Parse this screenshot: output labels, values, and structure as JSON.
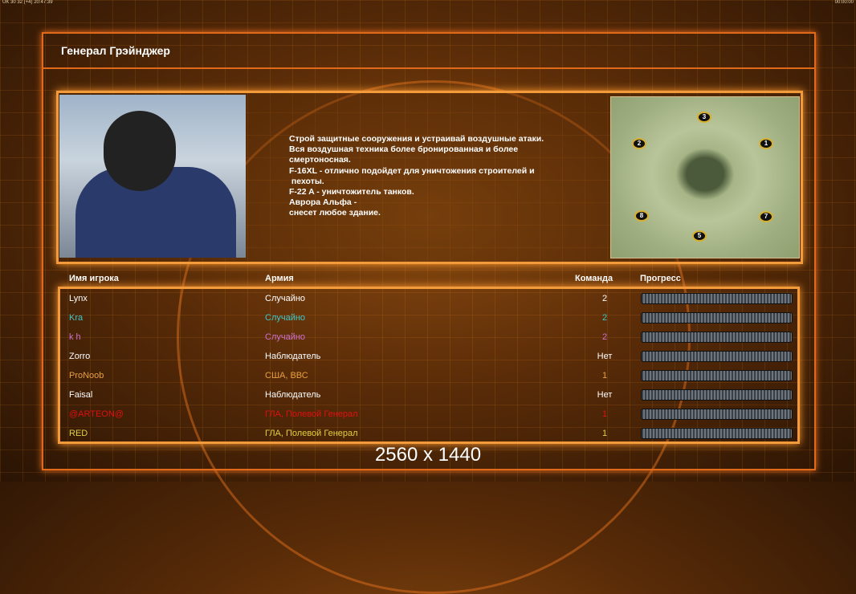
{
  "status_bar": {
    "left": "UK 30 32 (+4) 20:47:39",
    "right": "00:00:00"
  },
  "general": {
    "title": "Генерал Грэйнджер",
    "description": "Строй защитные сооружения и устраивай воздушные атаки.\nВся воздушная техника более бронированная и более\nсмертоносная.\nF-16XL - отлично подойдет для уничтожения строителей и\n пехоты.\nF-22 A - уничтожитель танков.\nАврора Альфа -\nснесет любое здание."
  },
  "map": {
    "start_positions": [
      "3",
      "2",
      "1",
      "8",
      "7",
      "5"
    ]
  },
  "table": {
    "headers": {
      "name": "Имя игрока",
      "army": "Армия",
      "team": "Команда",
      "progress": "Прогресс"
    },
    "rows": [
      {
        "name": "Lynx",
        "army": "Случайно",
        "team": "2",
        "color": "#ffffff",
        "progress": 0
      },
      {
        "name": "Kra",
        "army": "Случайно",
        "team": "2",
        "color": "#3fc8c8",
        "progress": 0
      },
      {
        "name": "k h",
        "army": "Случайно",
        "team": "2",
        "color": "#d070d0",
        "progress": 0
      },
      {
        "name": "Zorro",
        "army": "Наблюдатель",
        "team": "Нет",
        "color": "#ffffff",
        "progress": 0
      },
      {
        "name": "ProNoob",
        "army": "США, ВВС",
        "team": "1",
        "color": "#e8a040",
        "progress": 0
      },
      {
        "name": "Faisal",
        "army": "Наблюдатель",
        "team": "Нет",
        "color": "#ffffff",
        "progress": 0
      },
      {
        "name": "@ARTEON@",
        "army": "ГЛА, Полевой Генерал",
        "team": "1",
        "color": "#e01010",
        "progress": 0
      },
      {
        "name": "RED",
        "army": "ГЛА, Полевой Генерал",
        "team": "1",
        "color": "#e0d040",
        "progress": 0
      }
    ]
  },
  "resolution_label": "2560 x 1440"
}
